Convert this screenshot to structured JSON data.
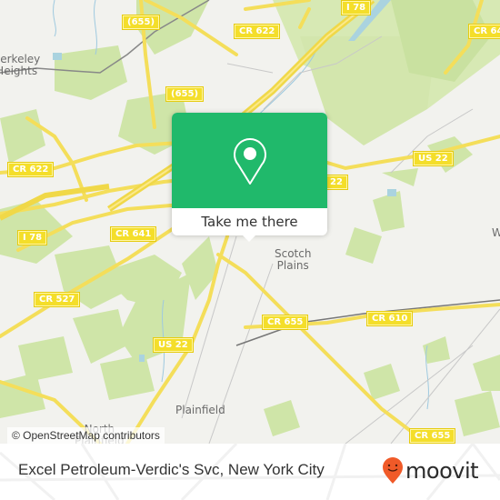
{
  "map": {
    "road_labels": [
      {
        "id": "655-top",
        "text": "(655)"
      },
      {
        "id": "i78-top",
        "text": "I 78"
      },
      {
        "id": "cr622-top",
        "text": "CR 622"
      },
      {
        "id": "cr64-right",
        "text": "CR 64"
      },
      {
        "id": "655-mid",
        "text": "(655)"
      },
      {
        "id": "cr622-left",
        "text": "CR 622"
      },
      {
        "id": "us22-right",
        "text": "US 22"
      },
      {
        "id": "us22-mid",
        "text": "22"
      },
      {
        "id": "i78-left",
        "text": "I 78"
      },
      {
        "id": "cr641",
        "text": "CR 641"
      },
      {
        "id": "cr527",
        "text": "CR 527"
      },
      {
        "id": "cr655-center",
        "text": "CR 655"
      },
      {
        "id": "cr610",
        "text": "CR 610"
      },
      {
        "id": "us22-bottom",
        "text": "US 22"
      },
      {
        "id": "cr655-bottom",
        "text": "CR 655"
      }
    ],
    "place_labels": [
      {
        "id": "berkeley-heights",
        "text": "Berkeley\nHeights"
      },
      {
        "id": "scotch-plains",
        "text": "Scotch\nPlains"
      },
      {
        "id": "plainfield",
        "text": "Plainfield"
      },
      {
        "id": "north-plainfield",
        "text": "North\nPlainfield"
      },
      {
        "id": "westfield",
        "text": "W"
      }
    ],
    "attribution": "© OpenStreetMap contributors"
  },
  "popup": {
    "icon": "map-pin-icon",
    "button_label": "Take me there",
    "accent_color": "#20b96b"
  },
  "footer": {
    "title": "Excel Petroleum-Verdic's Svc, New York City",
    "brand": "moovit",
    "brand_icon": "moovit-pin-icon",
    "brand_color": "#f05a28"
  }
}
